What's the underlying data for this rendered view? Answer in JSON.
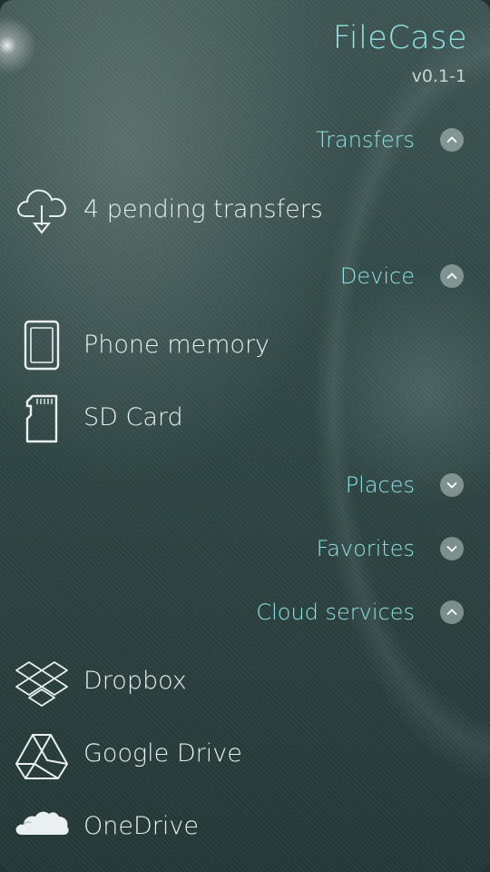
{
  "app": {
    "title": "FileCase",
    "version": "v0.1-1"
  },
  "sections": {
    "transfers": {
      "label": "Transfers",
      "expanded": true
    },
    "device": {
      "label": "Device",
      "expanded": true
    },
    "places": {
      "label": "Places",
      "expanded": false
    },
    "favorites": {
      "label": "Favorites",
      "expanded": false
    },
    "cloud": {
      "label": "Cloud services",
      "expanded": true
    }
  },
  "items": {
    "transfers": {
      "label": "4 pending transfers",
      "icon": "cloud-download-icon"
    },
    "phone": {
      "label": "Phone memory",
      "icon": "phone-icon"
    },
    "sd": {
      "label": "SD Card",
      "icon": "sd-card-icon"
    },
    "dropbox": {
      "label": "Dropbox",
      "icon": "dropbox-icon"
    },
    "gdrive": {
      "label": "Google Drive",
      "icon": "google-drive-icon"
    },
    "onedrive": {
      "label": "OneDrive",
      "icon": "onedrive-icon"
    }
  },
  "colors": {
    "accent": "#8fe3e2",
    "text": "#e9f0ef",
    "background": "#2b4140"
  }
}
